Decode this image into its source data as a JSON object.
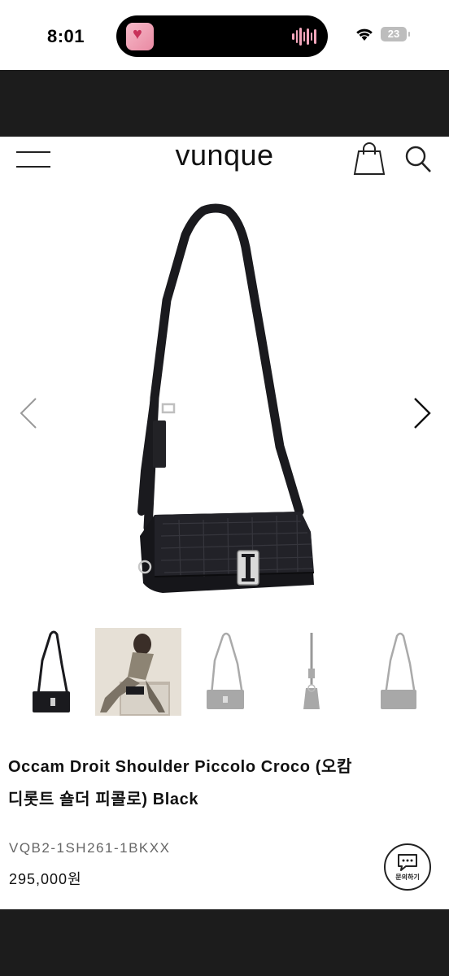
{
  "status_bar": {
    "time": "8:01",
    "battery": "23"
  },
  "header": {
    "brand": "vunque"
  },
  "product": {
    "title_line1": "Occam Droit Shoulder Piccolo Croco (오캄",
    "title_line2": "디롯트 숄더 피콜로) Black",
    "code": "VQB2-1SH261-1BKXX",
    "price": "295,000원"
  },
  "thumbnails": [
    {
      "kind": "bag-black",
      "active": true
    },
    {
      "kind": "model-photo",
      "active": false
    },
    {
      "kind": "bag-grey",
      "active": false
    },
    {
      "kind": "bag-side-grey",
      "active": false
    },
    {
      "kind": "bag-grey",
      "active": false
    }
  ],
  "inquiry_button": {
    "label": "문의하기"
  },
  "icons": {
    "menu": "menu-icon",
    "cart": "shopping-bag-icon",
    "search": "search-icon",
    "prev": "chevron-left-icon",
    "next": "chevron-right-icon",
    "chat": "chat-bubble-icon"
  },
  "colors": {
    "band": "#1c1c1c",
    "text": "#111111",
    "muted": "#666666"
  }
}
